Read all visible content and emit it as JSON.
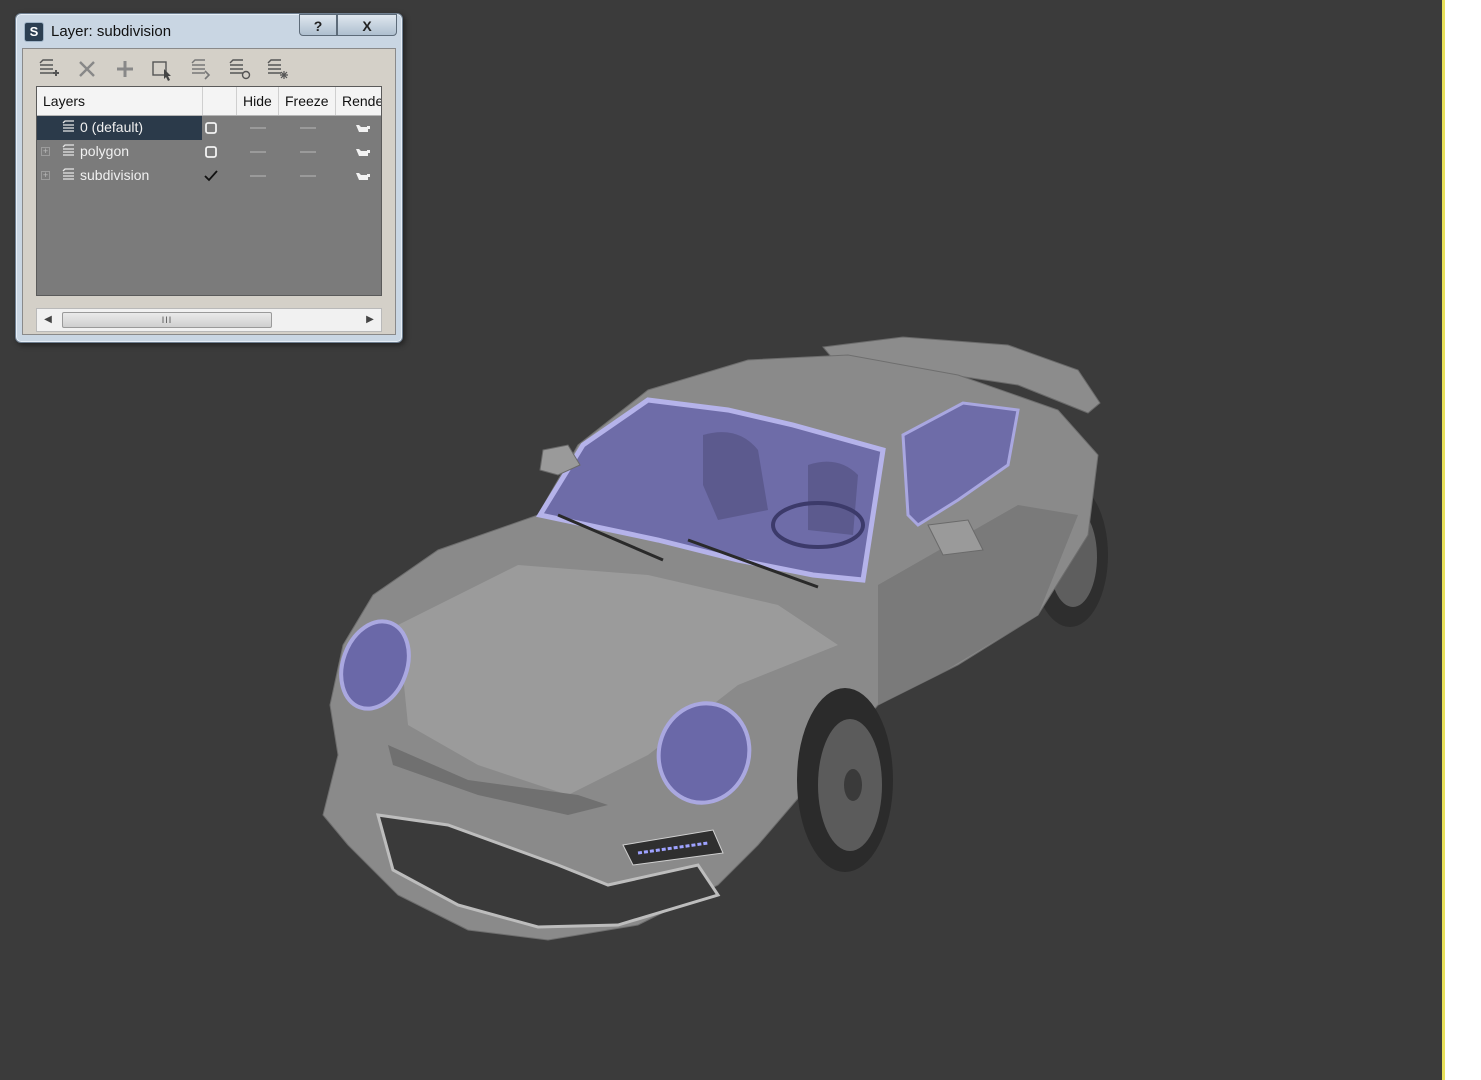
{
  "dialog": {
    "title": "Layer: subdivision",
    "help_label": "?",
    "close_label": "X",
    "toolbar": [
      {
        "name": "create-new-layer-icon"
      },
      {
        "name": "delete-layer-icon"
      },
      {
        "name": "add-selection-to-layer-icon"
      },
      {
        "name": "select-objects-in-layer-icon"
      },
      {
        "name": "highlight-selected-layers-icon"
      },
      {
        "name": "hide-unhide-all-layers-icon"
      },
      {
        "name": "freeze-unfreeze-all-layers-icon"
      }
    ],
    "columns": [
      "Layers",
      "",
      "Hide",
      "Freeze",
      "Rende"
    ],
    "layers": [
      {
        "name": "0 (default)",
        "selected": true,
        "current": false,
        "expandable": false
      },
      {
        "name": "polygon",
        "selected": false,
        "current": false,
        "expandable": true
      },
      {
        "name": "subdivision",
        "selected": false,
        "current": true,
        "expandable": true
      }
    ],
    "scroll_thumb_label": "III"
  },
  "colors": {
    "viewport_bg": "#3b3b3b",
    "viewport_border": "#e8e05a",
    "dialog_frame": "#c9d6e3",
    "selection": "#2b3a4a",
    "glass": "#7a78c8"
  }
}
